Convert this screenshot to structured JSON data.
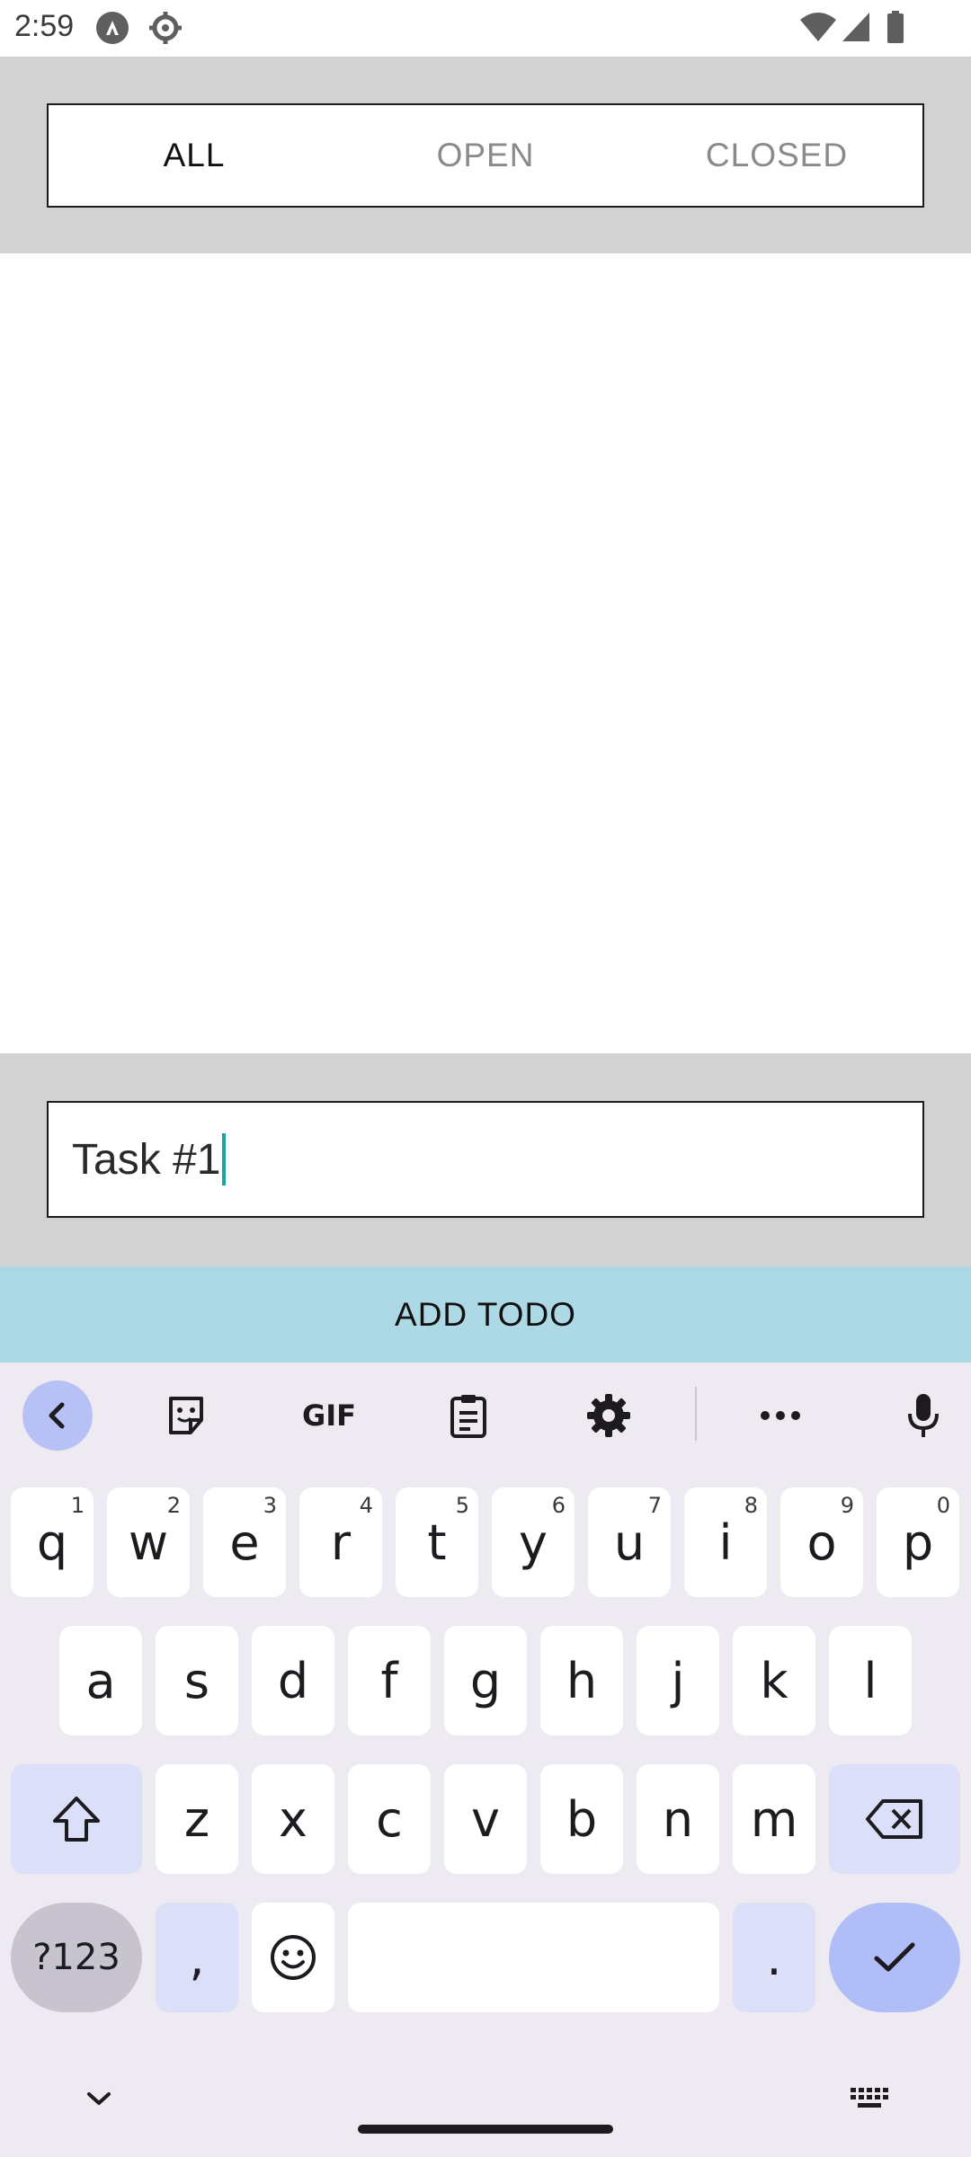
{
  "status_bar": {
    "time": "2:59",
    "icons_left": [
      "autopilot-icon",
      "settings-gear-icon"
    ],
    "icons_right": [
      "wifi-icon",
      "signal-icon",
      "battery-icon"
    ]
  },
  "filters": {
    "tabs": [
      {
        "label": "ALL",
        "active": true
      },
      {
        "label": "OPEN",
        "active": false
      },
      {
        "label": "CLOSED",
        "active": false
      }
    ]
  },
  "task_input": {
    "value": "Task #1"
  },
  "add_button": {
    "label": "ADD TODO",
    "color": "#add8e6"
  },
  "keyboard": {
    "toolbar": [
      "back-chevron-icon",
      "sticker-icon",
      "gif-icon",
      "clipboard-icon",
      "gear-icon",
      "more-icon",
      "mic-icon"
    ],
    "gif_label": "GIF",
    "row1": [
      {
        "key": "q",
        "hint": "1"
      },
      {
        "key": "w",
        "hint": "2"
      },
      {
        "key": "e",
        "hint": "3"
      },
      {
        "key": "r",
        "hint": "4"
      },
      {
        "key": "t",
        "hint": "5"
      },
      {
        "key": "y",
        "hint": "6"
      },
      {
        "key": "u",
        "hint": "7"
      },
      {
        "key": "i",
        "hint": "8"
      },
      {
        "key": "o",
        "hint": "9"
      },
      {
        "key": "p",
        "hint": "0"
      }
    ],
    "row2": [
      "a",
      "s",
      "d",
      "f",
      "g",
      "h",
      "j",
      "k",
      "l"
    ],
    "row3": [
      "z",
      "x",
      "c",
      "v",
      "b",
      "n",
      "m"
    ],
    "symbols_label": "?123",
    "comma": ",",
    "period": "."
  },
  "colors": {
    "panel_gray": "#d2d2d2",
    "caret": "#1aa6a0",
    "keyboard_bg": "#eeeaf2",
    "accent_key": "#b1bdf7"
  }
}
